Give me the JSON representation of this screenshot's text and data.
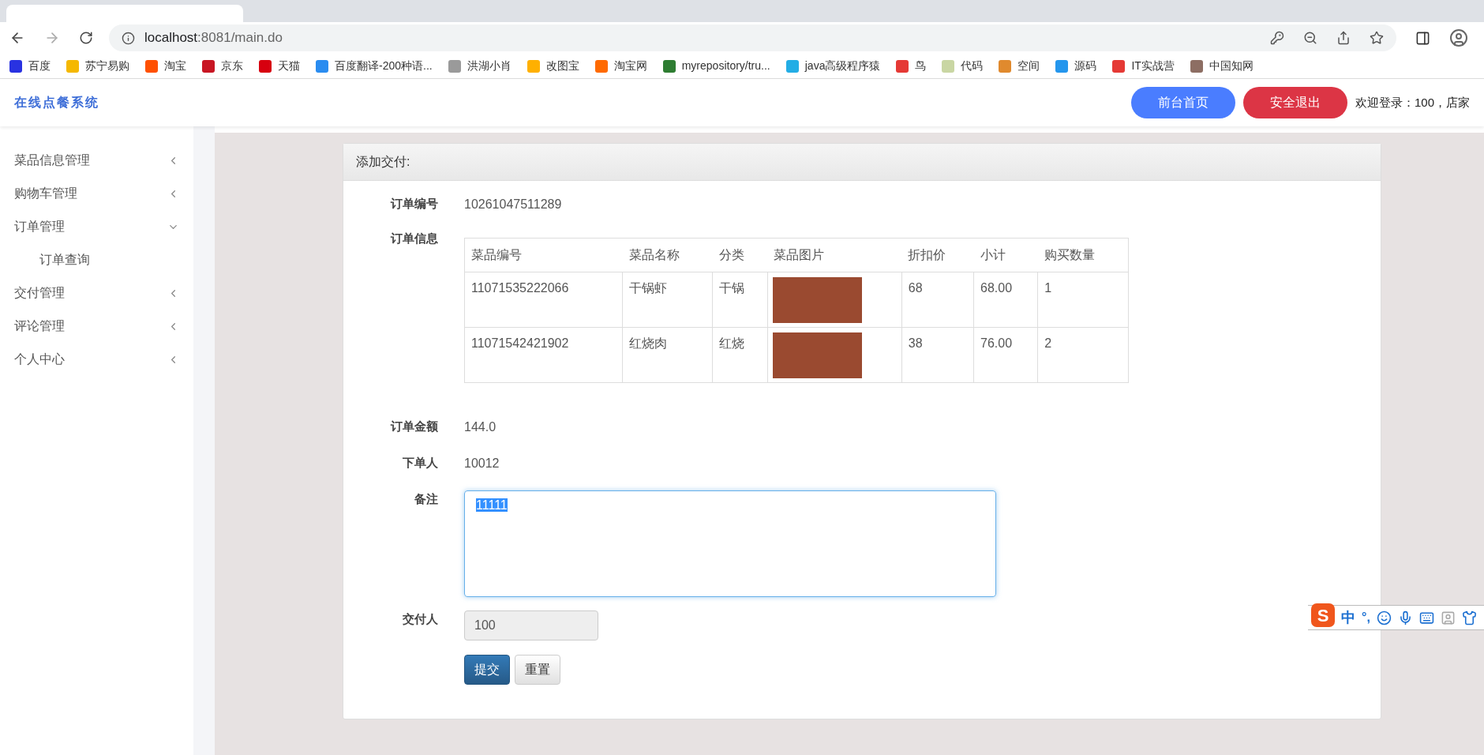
{
  "browser": {
    "address_host": "localhost",
    "address_path": ":8081/main.do",
    "bookmarks": [
      {
        "label": "百度",
        "color": "#2932e1"
      },
      {
        "label": "苏宁易购",
        "color": "#f5b800"
      },
      {
        "label": "淘宝",
        "color": "#ff5000"
      },
      {
        "label": "京东",
        "color": "#c81623"
      },
      {
        "label": "天猫",
        "color": "#d7000f"
      },
      {
        "label": "百度翻译-200种语...",
        "color": "#2a8cf0"
      },
      {
        "label": "洪湖小肖",
        "color": "#9a9a9a"
      },
      {
        "label": "改图宝",
        "color": "#ffb000"
      },
      {
        "label": "淘宝网",
        "color": "#ff6a00"
      },
      {
        "label": "myrepository/tru...",
        "color": "#2e7d32"
      },
      {
        "label": "java高级程序猿",
        "color": "#23ade5"
      },
      {
        "label": "鸟",
        "color": "#e53935"
      },
      {
        "label": "代码",
        "color": "#c9d6a3"
      },
      {
        "label": "空间",
        "color": "#e08a2e"
      },
      {
        "label": "源码",
        "color": "#2496ed"
      },
      {
        "label": "IT实战营",
        "color": "#e53935"
      },
      {
        "label": "中国知网",
        "color": "#8d6e63"
      }
    ]
  },
  "header": {
    "logo": "在线点餐系统",
    "buttons": [
      {
        "label": "前台首页",
        "kind": "primary"
      },
      {
        "label": "安全退出",
        "kind": "danger"
      }
    ],
    "welcome": "欢迎登录：100，店家"
  },
  "sidebar": {
    "items": [
      {
        "label": "菜品信息管理",
        "expanded": false
      },
      {
        "label": "购物车管理",
        "expanded": false
      },
      {
        "label": "订单管理",
        "expanded": true,
        "children": [
          {
            "label": "订单查询"
          }
        ]
      },
      {
        "label": "交付管理",
        "expanded": false
      },
      {
        "label": "评论管理",
        "expanded": false
      },
      {
        "label": "个人中心",
        "expanded": false
      }
    ]
  },
  "form": {
    "title": "添加交付:",
    "order_no": {
      "label": "订单编号",
      "value": "10261047511289"
    },
    "order_info": {
      "label": "订单信息",
      "columns": [
        "菜品编号",
        "菜品名称",
        "分类",
        "菜品图片",
        "折扣价",
        "小计",
        "购买数量"
      ],
      "rows": [
        {
          "cells": [
            "11071535222066",
            "干锅虾",
            "干锅",
            "",
            "68",
            "68.00",
            "1"
          ]
        },
        {
          "cells": [
            "11071542421902",
            "红烧肉",
            "红烧",
            "",
            "38",
            "76.00",
            "2"
          ]
        }
      ]
    },
    "amount": {
      "label": "订单金额",
      "value": "144.0"
    },
    "orderer": {
      "label": "下单人",
      "value": "10012"
    },
    "remark": {
      "label": "备注",
      "value": "11111",
      "value_selected": true
    },
    "deliverer": {
      "label": "交付人",
      "value": "100",
      "disabled": true
    },
    "buttons": [
      {
        "label": "提交",
        "kind": "primary"
      },
      {
        "label": "重置",
        "kind": "default"
      }
    ]
  },
  "ime": {
    "logo": "S",
    "mode": "中",
    "punct": "°,"
  }
}
